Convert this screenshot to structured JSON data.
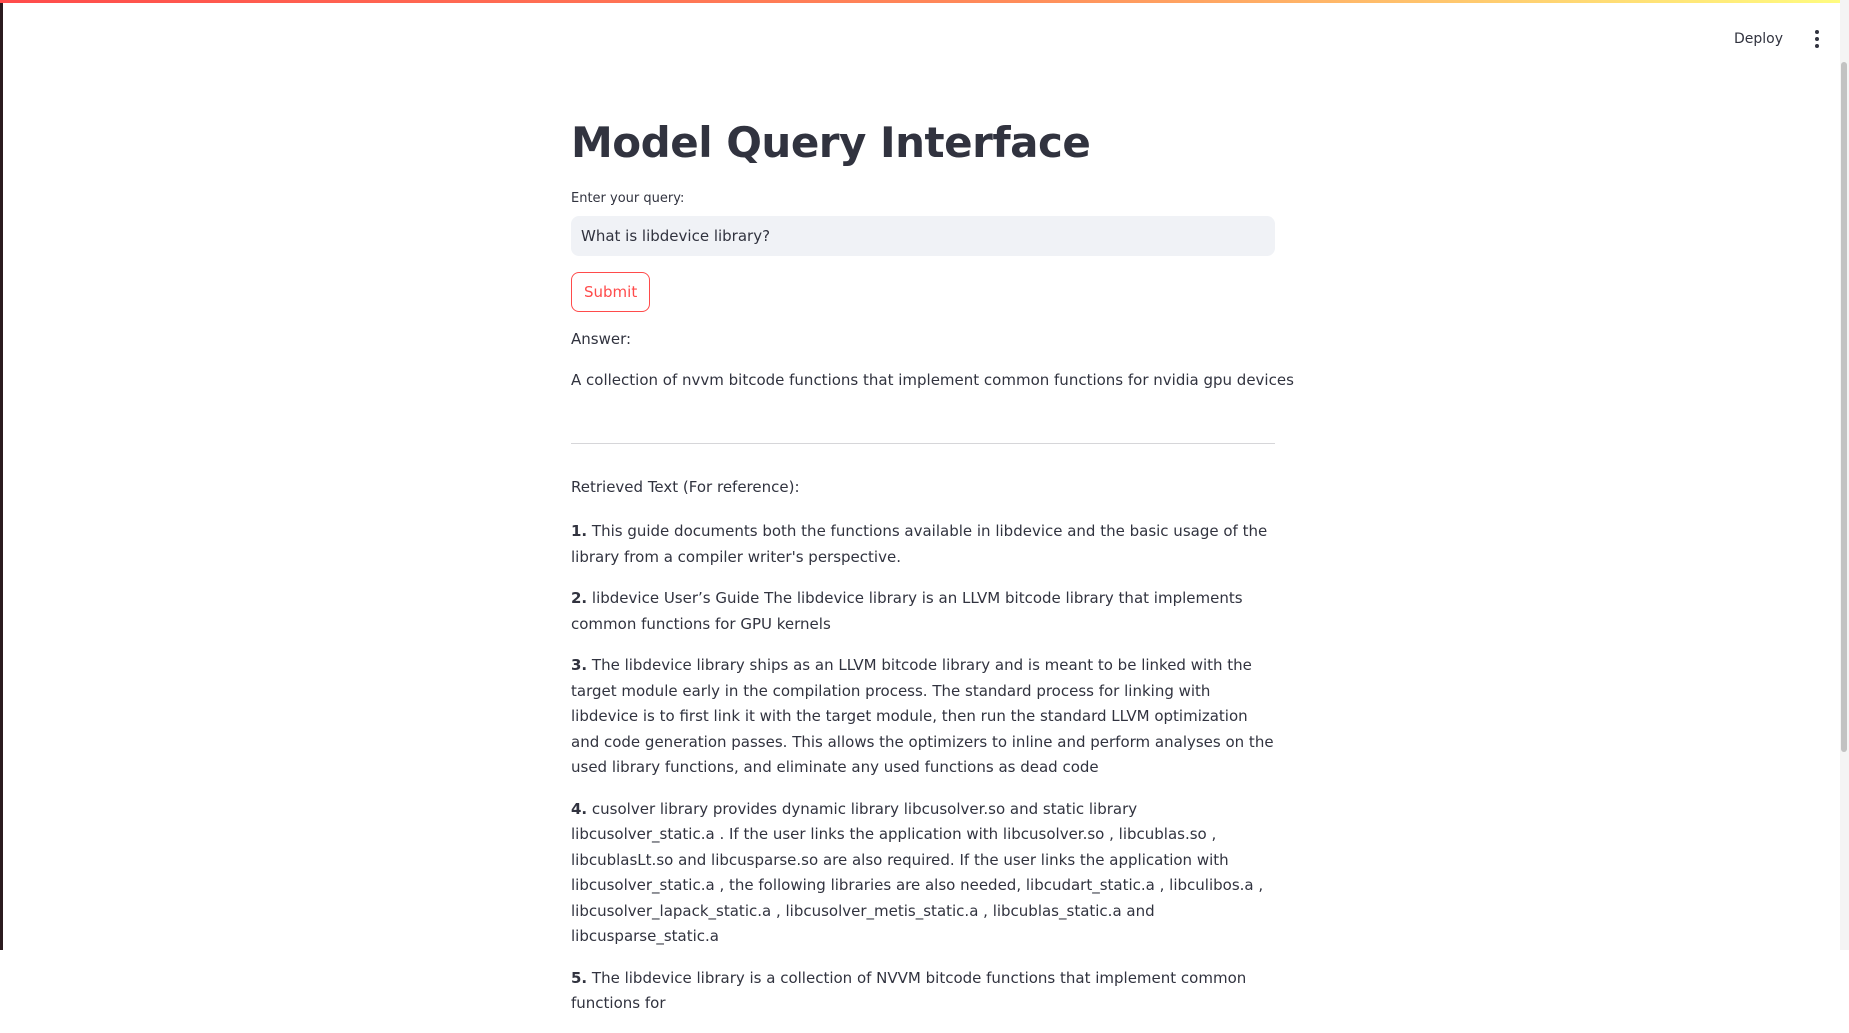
{
  "header": {
    "deploy_label": "Deploy",
    "menu_icon": "kebab-menu-icon"
  },
  "colors": {
    "accent": "#ff4b4b",
    "text": "#31333f",
    "input_bg": "#f0f2f6"
  },
  "main": {
    "title": "Model Query Interface",
    "query_label": "Enter your query:",
    "query_value": "What is libdevice library?",
    "submit_label": "Submit",
    "answer_label": "Answer:",
    "answer_text": "A collection of nvvm bitcode functions that implement common functions for nvidia gpu devices",
    "retrieved_label": "Retrieved Text (For reference):",
    "references": [
      {
        "num": "1.",
        "text": "This guide documents both the functions available in libdevice and the basic usage of the library from a compiler writer's perspective."
      },
      {
        "num": "2.",
        "text": "libdevice User’s Guide The libdevice library is an LLVM bitcode library that implements common functions for GPU kernels"
      },
      {
        "num": "3.",
        "text": "The libdevice library ships as an LLVM bitcode library and is meant to be linked with the target module early in the compilation process. The standard process for linking with libdevice is to first link it with the target module, then run the standard LLVM optimization and code generation passes. This allows the optimizers to inline and perform analyses on the used library functions, and eliminate any used functions as dead code"
      },
      {
        "num": "4.",
        "text": "cusolver library provides dynamic library libcusolver.so and static library libcusolver_static.a . If the user links the application with libcusolver.so , libcublas.so , libcublasLt.so and libcusparse.so are also required. If the user links the application with libcusolver_static.a , the following libraries are also needed, libcudart_static.a , libculibos.a , libcusolver_lapack_static.a , libcusolver_metis_static.a , libcublas_static.a and libcusparse_static.a"
      },
      {
        "num": "5.",
        "text": "The libdevice library is a collection of NVVM bitcode functions that implement common functions for"
      }
    ]
  }
}
